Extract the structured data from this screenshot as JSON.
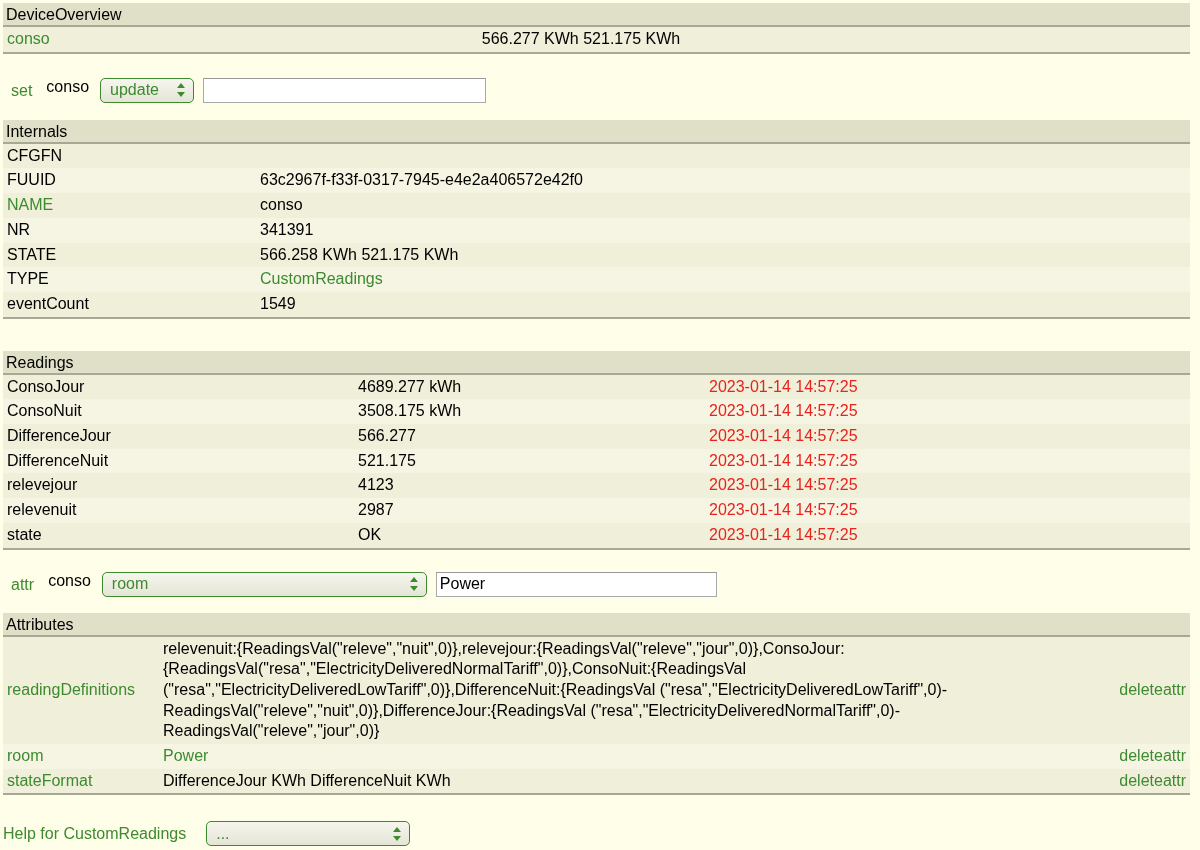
{
  "device_overview": {
    "title": "DeviceOverview",
    "rows": [
      {
        "cells": [
          {
            "text": "conso",
            "link": true
          },
          {
            "text": "566.277 KWh 521.175 KWh",
            "link": false
          }
        ]
      }
    ]
  },
  "set_command": {
    "command": "set",
    "device": "conso",
    "select": "update"
  },
  "internals": {
    "title": "Internals",
    "rows": [
      {
        "cells": [
          {
            "text": "CFGFN",
            "link": false
          }
        ]
      },
      {
        "cells": [
          {
            "text": "FUUID",
            "link": false
          },
          {
            "text": "63c2967f-f33f-0317-7945-e4e2a406572e42f0",
            "link": false
          }
        ]
      },
      {
        "cells": [
          {
            "text": "NAME",
            "link": true
          },
          {
            "text": "conso",
            "link": false
          }
        ]
      },
      {
        "cells": [
          {
            "text": "NR",
            "link": false
          },
          {
            "text": "341391",
            "link": false
          }
        ]
      },
      {
        "cells": [
          {
            "text": "STATE",
            "link": false
          },
          {
            "text": "566.258 KWh 521.175 KWh",
            "link": false
          }
        ]
      },
      {
        "cells": [
          {
            "text": "TYPE",
            "link": false
          },
          {
            "text": "CustomReadings",
            "link": true
          }
        ]
      },
      {
        "cells": [
          {
            "text": "eventCount",
            "link": false
          },
          {
            "text": "1549",
            "link": false
          }
        ]
      }
    ]
  },
  "readings": {
    "title": "Readings",
    "rows": [
      {
        "cells": [
          {
            "text": "ConsoJour",
            "link": false
          },
          {
            "text": "4689.277 kWh",
            "link": false
          },
          {
            "text": "2023-01-14 14:57:25",
            "kind": "time"
          }
        ]
      },
      {
        "cells": [
          {
            "text": "ConsoNuit",
            "link": false
          },
          {
            "text": "3508.175 kWh",
            "link": false
          },
          {
            "text": "2023-01-14 14:57:25",
            "kind": "time"
          }
        ]
      },
      {
        "cells": [
          {
            "text": "DifferenceJour",
            "link": false
          },
          {
            "text": "566.277",
            "link": false
          },
          {
            "text": "2023-01-14 14:57:25",
            "kind": "time"
          }
        ]
      },
      {
        "cells": [
          {
            "text": "DifferenceNuit",
            "link": false
          },
          {
            "text": "521.175",
            "link": false
          },
          {
            "text": "2023-01-14 14:57:25",
            "kind": "time"
          }
        ]
      },
      {
        "cells": [
          {
            "text": "relevejour",
            "link": false
          },
          {
            "text": "4123",
            "link": false
          },
          {
            "text": "2023-01-14 14:57:25",
            "kind": "time"
          }
        ]
      },
      {
        "cells": [
          {
            "text": "relevenuit",
            "link": false
          },
          {
            "text": "2987",
            "link": false
          },
          {
            "text": "2023-01-14 14:57:25",
            "kind": "time"
          }
        ]
      },
      {
        "cells": [
          {
            "text": "state",
            "link": false
          },
          {
            "text": "OK",
            "link": false
          },
          {
            "text": "2023-01-14 14:57:25",
            "kind": "time"
          }
        ]
      }
    ]
  },
  "attr_command": {
    "command": "attr",
    "device": "conso",
    "select": "room",
    "value": "Power"
  },
  "attributes": {
    "title": "Attributes",
    "rows": [
      {
        "cells": [
          {
            "text": "readingDefinitions",
            "link": true
          },
          {
            "text": "relevenuit:{ReadingsVal(\"releve\",\"nuit\",0)},relevejour:{ReadingsVal(\"releve\",\"jour\",0)},ConsoJour:{ReadingsVal(\"resa\",\"ElectricityDeliveredNormalTariff\",0)},ConsoNuit:{ReadingsVal (\"resa\",\"ElectricityDeliveredLowTariff\",0)},DifferenceNuit:{ReadingsVal (\"resa\",\"ElectricityDeliveredLowTariff\",0)-ReadingsVal(\"releve\",\"nuit\",0)},DifferenceJour:{ReadingsVal (\"resa\",\"ElectricityDeliveredNormalTariff\",0)-ReadingsVal(\"releve\",\"jour\",0)}",
            "link": false
          },
          {
            "text": "deleteattr",
            "link": true
          }
        ]
      },
      {
        "cells": [
          {
            "text": "room",
            "link": true
          },
          {
            "text": "Power",
            "link": true
          },
          {
            "text": "deleteattr",
            "link": true
          }
        ]
      },
      {
        "cells": [
          {
            "text": "stateFormat",
            "link": true
          },
          {
            "text": "DifferenceJour KWh DifferenceNuit KWh",
            "link": false
          },
          {
            "text": "deleteattr",
            "link": true
          }
        ]
      }
    ]
  },
  "help": {
    "label": "Help for CustomReadings",
    "select": "..."
  }
}
